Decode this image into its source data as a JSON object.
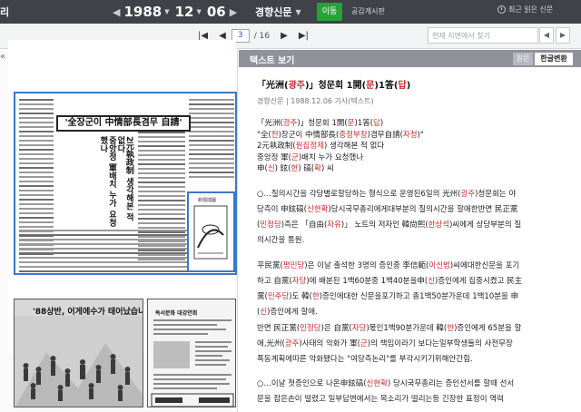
{
  "topbar": {
    "app_title": "리",
    "date": {
      "year": "1988",
      "month": "12",
      "day": "06"
    },
    "paper": "경향신문",
    "move_label": "이동",
    "calendar_label": "공감게시판",
    "history_label": "최근 읽은 신문"
  },
  "pager": {
    "current": "3",
    "total": "/ 16",
    "search_placeholder": "현재 지면에서 찾기"
  },
  "newspaper": {
    "headline": "'全장군이 中情部長겸무 自請'",
    "vertical_head_1": "중앙정 軍배치 누가 요청했나",
    "vertical_head_2": "2元執政制 생각해본 적 없다",
    "small_caption": "新聞插圖",
    "ad1_title": "'88상반, 어게에수가 태어났습니다.",
    "ad2_title": "독서문화 대강연회"
  },
  "panel": {
    "header": "텍스트 보기",
    "tab_original": "원문",
    "tab_converted": "한글변환",
    "article_title": "「光洲(광주)」청문회 1開(문)1答(답)",
    "meta": "경향신문 | 1988.12.06 기사(텍스트)",
    "lines": [
      "「光洲(광주)」청문회 1開(문)1答(답)",
      "\"全(전)장군이 中情部長(중정부장)겸무自請(자청)\"",
      "2元執政制(원집정제) 생각해본 적 없다",
      "중앙정 軍(군)배치 누가 요청했나",
      "申(신) 鉉(현) 碻(확) 씨"
    ],
    "para1": [
      "○…질의시간을 각당별로할당하는 형식으로 운영된6일의 光州(광주)청문회는 야",
      "당측이 申鉉碻(신현확)당시국무총리에게대부분의 질의시간을 할애한반면 民正黨",
      "(민정당)측은 「自由(자유)」 노트의 저자인 韓尙熙(한상석)씨에게 상당부분의 질",
      "의시간을 통원."
    ],
    "para2": [
      "平民黨(평민당)은 이날 출석한 3명의 증인중 李信範(이신범)씨에대한신문을 포기",
      "하고 自黨(자당)에 배분된 1백60분중 1백40분을申(신)증인에게 집중시켰고 民主",
      "黨(민주당)도 韓(한)증인에대한 신문을포기하고 총1백50분가운데 1백10분을 申",
      "(신)증인에게 할애."
    ],
    "para3": [
      "반면 民正黨(민정당)은 自黨(자당)몫인1백90분가운데 韓(한)증인에게 65분을 할",
      "애,光州(광주)사태의 악화가 軍(군)의 책임이라기 보다는일부학생들의 사전무장",
      "폭동계획에따른 악화됐다는 \"여당측논리\"를 부각시키기위해안간힘."
    ],
    "para4": [
      "○…이날 첫증인으로 나온申鉉碻(신현확) 당시국무총리는 증인선서를 할때 선서",
      "문을 잡은손이 떨렸고 일부답변에서는 목소리가 떨리는등 긴장한 표정이 역력"
    ]
  }
}
